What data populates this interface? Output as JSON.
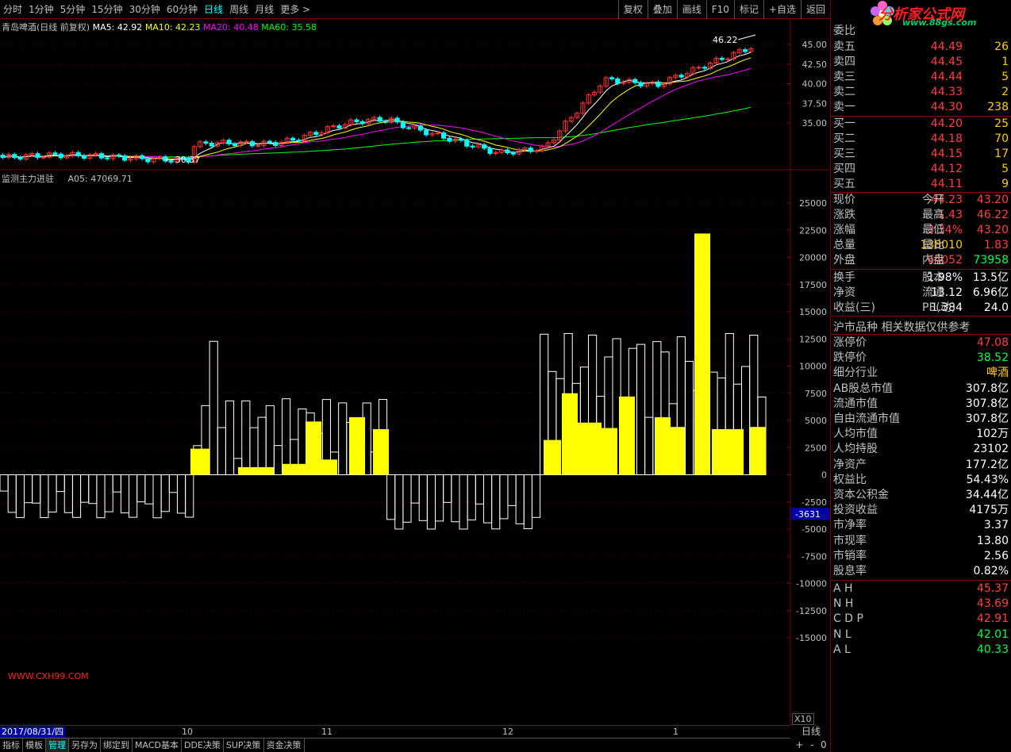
{
  "toolbar": {
    "periods": [
      "分时",
      "1分钟",
      "5分钟",
      "15分钟",
      "30分钟",
      "60分钟",
      "日线",
      "周线",
      "月线",
      "更多 >"
    ],
    "active_period": "日线",
    "tools": [
      "复权",
      "叠加",
      "画线",
      "F10",
      "标记",
      "+自选",
      "返回"
    ]
  },
  "legend": {
    "stock": "青岛啤酒(日线 前复权)",
    "ma5": "MA5: 42.92",
    "ma10": "MA10: 42.23",
    "ma20": "MA20: 40.48",
    "ma60": "MA60: 35.58",
    "indicator": "监测主力进驻",
    "a05": "A05: 47069.71"
  },
  "colors": {
    "ma5": "#ffffff",
    "ma10": "#ffff00",
    "ma20": "#ff00ff",
    "ma60": "#00ff00",
    "up": "#ff3333",
    "down": "#00ffff",
    "bar": "#ffff00",
    "grid": "#800000"
  },
  "price_axis": [
    "45.00",
    "42.50",
    "40.00",
    "37.50",
    "35.00"
  ],
  "price_marks": {
    "high": "46.22",
    "low": "30.37"
  },
  "ind_axis": [
    "25000",
    "22500",
    "20000",
    "17500",
    "15000",
    "12500",
    "10000",
    "7500",
    "5000",
    "2500",
    "0",
    "-2500",
    "-5000",
    "-7500",
    "-10000",
    "-12500",
    "-15000"
  ],
  "cursor_value": "-3631",
  "watermark": "WWW.CXH99.COM",
  "date_cursor": "2017/08/31/四",
  "months": [
    "10",
    "11",
    "12",
    "1"
  ],
  "x10": "X10",
  "period_label": "日线",
  "zoom": [
    "+",
    "-",
    "0"
  ],
  "bottom_tabs": [
    "指标",
    "模板",
    "管理",
    "另存为",
    "绑定到",
    "MACD基本",
    "DDE决策",
    "SUP决策",
    "资金决策"
  ],
  "bottom_active": "管理",
  "panel": {
    "logo": "分析家公式网",
    "logo_url": "www.88gs.com",
    "order_ratio_label": "委比",
    "asks": [
      {
        "label": "卖五",
        "price": "44.49",
        "vol": "26"
      },
      {
        "label": "卖四",
        "price": "44.45",
        "vol": "1"
      },
      {
        "label": "卖三",
        "price": "44.44",
        "vol": "5"
      },
      {
        "label": "卖二",
        "price": "44.33",
        "vol": "2"
      },
      {
        "label": "卖一",
        "price": "44.30",
        "vol": "238"
      }
    ],
    "bids": [
      {
        "label": "买一",
        "price": "44.20",
        "vol": "25"
      },
      {
        "label": "买二",
        "price": "44.18",
        "vol": "70"
      },
      {
        "label": "买三",
        "price": "44.15",
        "vol": "17"
      },
      {
        "label": "买四",
        "price": "44.12",
        "vol": "5"
      },
      {
        "label": "买五",
        "price": "44.11",
        "vol": "9"
      }
    ],
    "quote": [
      {
        "l1": "现价",
        "v1": "44.23",
        "c1": "red",
        "l2": "今开",
        "v2": "43.20",
        "c2": "red"
      },
      {
        "l1": "涨跌",
        "v1": "1.43",
        "c1": "red",
        "l2": "最高",
        "v2": "46.22",
        "c2": "red"
      },
      {
        "l1": "涨幅",
        "v1": "3.34%",
        "c1": "red",
        "l2": "最低",
        "v2": "43.20",
        "c2": "red"
      },
      {
        "l1": "总量",
        "v1": "138010",
        "c1": "orange",
        "l2": "量比",
        "v2": "1.83",
        "c2": "red"
      },
      {
        "l1": "外盘",
        "v1": "64052",
        "c1": "red",
        "l2": "内盘",
        "v2": "73958",
        "c2": "green"
      }
    ],
    "fund": [
      {
        "l1": "换手",
        "v1": "1.98%",
        "l2": "股本",
        "v2": "13.5亿"
      },
      {
        "l1": "净资",
        "v1": "13.12",
        "l2": "流通",
        "v2": "6.96亿"
      },
      {
        "l1": "收益(三)",
        "v1": "1.384",
        "l2": "PE(动)",
        "v2": "24.0"
      }
    ],
    "section_title": "沪市品种  相关数据仅供参考",
    "details": [
      {
        "label": "涨停价",
        "value": "47.08",
        "color": "red"
      },
      {
        "label": "跌停价",
        "value": "38.52",
        "color": "green"
      },
      {
        "label": "细分行业",
        "value": "啤酒",
        "color": "orange"
      },
      {
        "label": "AB股总市值",
        "value": "307.8亿",
        "color": "white"
      },
      {
        "label": "流通市值",
        "value": "307.8亿",
        "color": "white"
      },
      {
        "label": "自由流通市值",
        "value": "307.8亿",
        "color": "white"
      },
      {
        "label": "人均市值",
        "value": "102万",
        "color": "white"
      },
      {
        "label": "人均持股",
        "value": "23102",
        "color": "white"
      },
      {
        "label": "净资产",
        "value": "177.2亿",
        "color": "white"
      },
      {
        "label": "权益比",
        "value": "54.43%",
        "color": "white"
      },
      {
        "label": "资本公积金",
        "value": "34.44亿",
        "color": "white"
      },
      {
        "label": "投资收益",
        "value": "4175万",
        "color": "white"
      },
      {
        "label": "市净率",
        "value": "3.37",
        "color": "white"
      },
      {
        "label": "市现率",
        "value": "13.80",
        "color": "white"
      },
      {
        "label": "市销率",
        "value": "2.56",
        "color": "white"
      },
      {
        "label": "股息率",
        "value": "0.82%",
        "color": "white"
      }
    ],
    "lines": [
      {
        "label": "A H",
        "value": "45.37",
        "color": "red"
      },
      {
        "label": "N H",
        "value": "43.69",
        "color": "red"
      },
      {
        "label": "C D P",
        "value": "42.91",
        "color": "red"
      },
      {
        "label": "N L",
        "value": "42.01",
        "color": "green"
      },
      {
        "label": "A L",
        "value": "40.33",
        "color": "green"
      }
    ]
  },
  "chart_data": {
    "type": "bar",
    "ind_ylim": [
      -15000,
      25000
    ],
    "bars_yellow": [
      {
        "x": 0.24,
        "w": 0.024,
        "v": 2400
      },
      {
        "x": 0.3,
        "w": 0.045,
        "v": 700
      },
      {
        "x": 0.355,
        "w": 0.03,
        "v": 1000
      },
      {
        "x": 0.385,
        "w": 0.02,
        "v": 4900
      },
      {
        "x": 0.405,
        "w": 0.02,
        "v": 1400
      },
      {
        "x": 0.44,
        "w": 0.02,
        "v": 5300
      },
      {
        "x": 0.47,
        "w": 0.02,
        "v": 4200
      },
      {
        "x": 0.685,
        "w": 0.022,
        "v": 3200
      },
      {
        "x": 0.708,
        "w": 0.02,
        "v": 7500
      },
      {
        "x": 0.728,
        "w": 0.03,
        "v": 4800
      },
      {
        "x": 0.758,
        "w": 0.02,
        "v": 4300
      },
      {
        "x": 0.78,
        "w": 0.02,
        "v": 7200
      },
      {
        "x": 0.825,
        "w": 0.02,
        "v": 5300
      },
      {
        "x": 0.845,
        "w": 0.018,
        "v": 4400
      },
      {
        "x": 0.875,
        "w": 0.02,
        "v": 22200
      },
      {
        "x": 0.897,
        "w": 0.04,
        "v": 4200
      },
      {
        "x": 0.945,
        "w": 0.02,
        "v": 4400
      }
    ]
  }
}
